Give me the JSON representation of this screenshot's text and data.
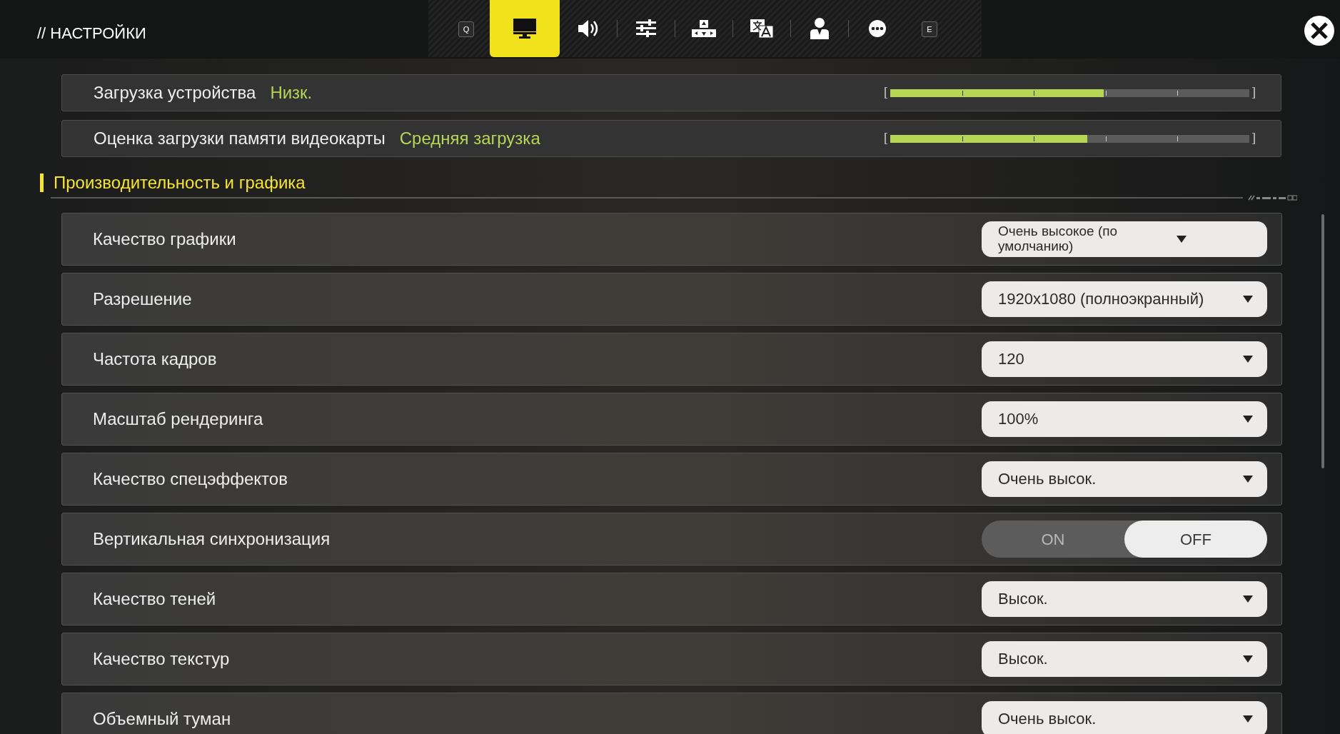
{
  "header": {
    "title": "// НАСТРОЙКИ"
  },
  "tabs": [
    {
      "kind": "key",
      "label": "Q",
      "selected": false
    },
    {
      "kind": "display",
      "selected": true
    },
    {
      "kind": "sound",
      "selected": false
    },
    {
      "kind": "sliders",
      "selected": false
    },
    {
      "kind": "keys",
      "selected": false
    },
    {
      "kind": "translate",
      "selected": false
    },
    {
      "kind": "person",
      "selected": false
    },
    {
      "kind": "more",
      "selected": false
    },
    {
      "kind": "key",
      "label": "E",
      "selected": false
    }
  ],
  "meters": [
    {
      "label": "Загрузка устройства",
      "value": "Низк.",
      "level": 0.595
    },
    {
      "label": "Оценка загрузки памяти видеокарты",
      "value": "Средняя загрузка",
      "level": 0.548
    }
  ],
  "section": {
    "title": "Производительность и графика"
  },
  "settings": [
    {
      "kind": "dropdown",
      "label": "Качество графики",
      "value": "Очень высокое (по умолчанию)"
    },
    {
      "kind": "dropdown",
      "label": "Разрешение",
      "value": "1920x1080 (полноэкранный)"
    },
    {
      "kind": "dropdown",
      "label": "Частота кадров",
      "value": "120"
    },
    {
      "kind": "dropdown",
      "label": "Масштаб рендеринга",
      "value": "100%"
    },
    {
      "kind": "dropdown",
      "label": "Качество спецэффектов",
      "value": "Очень высок."
    },
    {
      "kind": "toggle",
      "label": "Вертикальная синхронизация",
      "options": [
        {
          "label": "ON",
          "selected": false
        },
        {
          "label": "OFF",
          "selected": true
        }
      ]
    },
    {
      "kind": "dropdown",
      "label": "Качество теней",
      "value": "Высок."
    },
    {
      "kind": "dropdown",
      "label": "Качество текстур",
      "value": "Высок."
    },
    {
      "kind": "dropdown",
      "label": "Объемный туман",
      "value": "Очень высок."
    }
  ]
}
